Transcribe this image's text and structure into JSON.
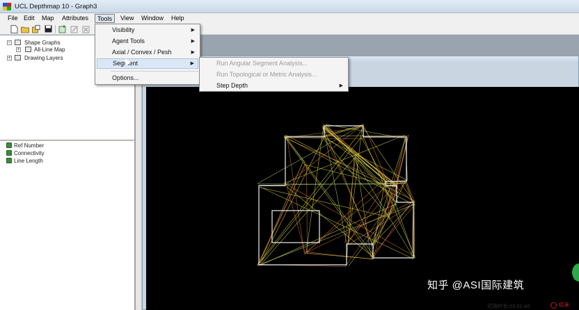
{
  "window": {
    "title": "UCL Depthmap 10 - Graph3"
  },
  "menubar": {
    "items": [
      {
        "label": "File"
      },
      {
        "label": "Edit"
      },
      {
        "label": "Map"
      },
      {
        "label": "Attributes"
      },
      {
        "label": "Tools"
      },
      {
        "label": "View"
      },
      {
        "label": "Window"
      },
      {
        "label": "Help"
      }
    ]
  },
  "toolbar": {
    "buttons": [
      "new-document-icon",
      "open-folder-icon",
      "import-icon",
      "save-disk-icon",
      "new-map-icon",
      "edit-map-icon",
      "delete-map-icon"
    ]
  },
  "tree": {
    "shape_graphs": "Shape Graphs",
    "all_line_map": "All-Line Map",
    "drawing_layers": "Drawing Layers"
  },
  "attributes": {
    "items": [
      {
        "label": "Ref Number"
      },
      {
        "label": "Connectivity"
      },
      {
        "label": "Line Length"
      }
    ]
  },
  "tools_menu": {
    "items": [
      {
        "label": "Visibility",
        "submenu": true
      },
      {
        "label": "Agent Tools",
        "submenu": true
      },
      {
        "label": "Axial / Convex / Pesh",
        "submenu": true
      },
      {
        "label": "Segment",
        "submenu": true,
        "highlighted": true
      },
      {
        "label": "Options...",
        "submenu": false
      }
    ]
  },
  "segment_menu": {
    "items": [
      {
        "label": "Run Angular Segment Analysis...",
        "enabled": false
      },
      {
        "label": "Run Topological or Metric Analysis...",
        "enabled": false
      },
      {
        "label": "Step Depth",
        "enabled": true,
        "submenu": true
      }
    ]
  },
  "overlay": {
    "elapsed_time": "可用时长:03:51:40",
    "end_label": "结束",
    "watermark": "知乎 @ASI国际建筑"
  },
  "colors": {
    "canvas_bg": "#000000",
    "map_outline": "#f0f0f0",
    "line_warm": "#e07a3a",
    "line_yellow": "#e8e040",
    "line_green": "#b8e070",
    "end_red": "#c02020"
  }
}
